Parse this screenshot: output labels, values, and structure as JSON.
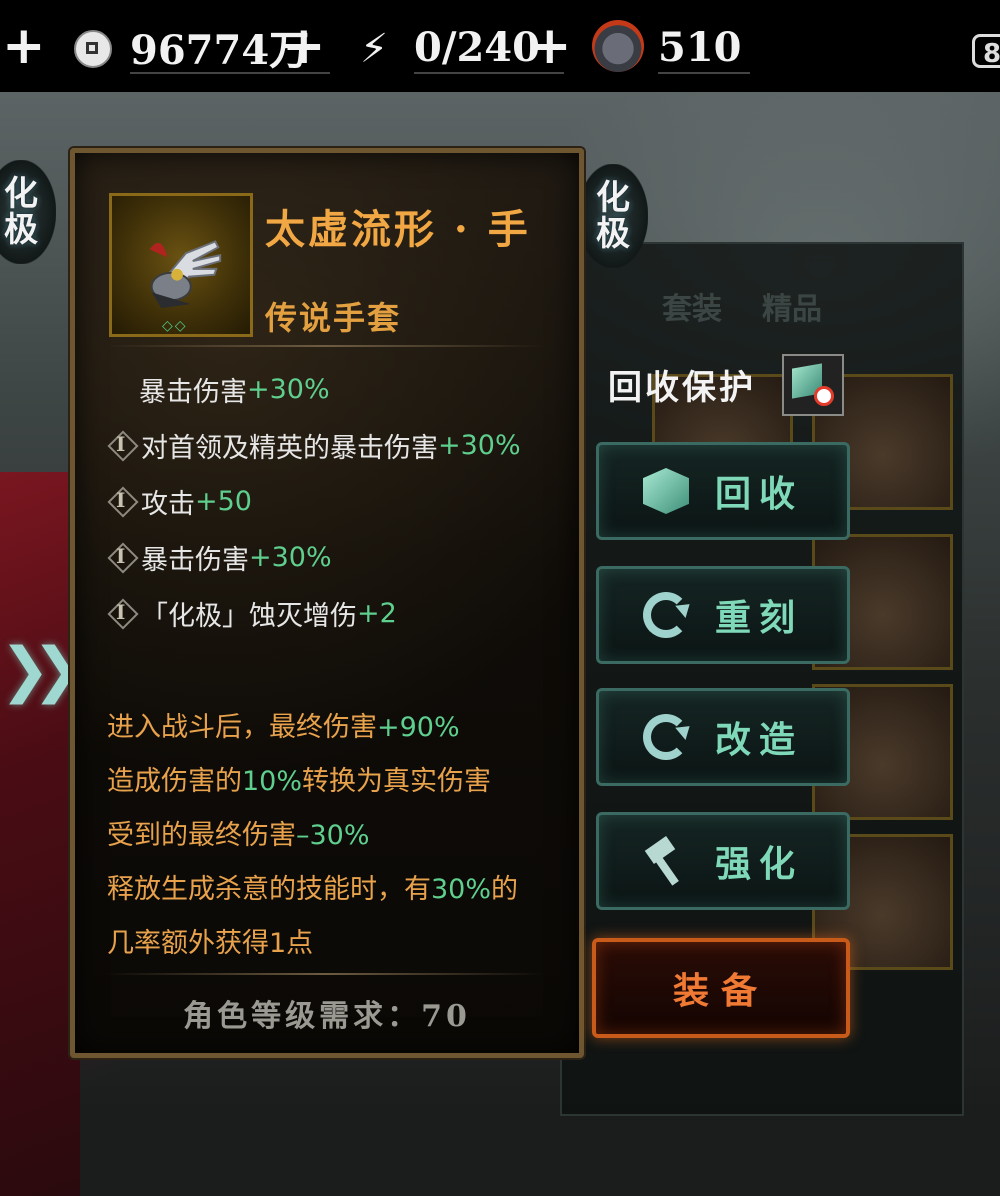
{
  "topbar": {
    "left_plus": "+",
    "currency_value": "96774万",
    "currency_plus": "+",
    "energy_value": "0/240",
    "energy_plus": "+",
    "medal_value": "510",
    "right_value": "8"
  },
  "badges": {
    "left": [
      "化",
      "极"
    ],
    "right": [
      "化",
      "极"
    ]
  },
  "item": {
    "name": "太虚流形 · 手",
    "type": "传说手套",
    "rarity_marks": "◇◇",
    "stats": [
      {
        "label": "暴击伤害",
        "value": "+30%",
        "icon": false
      },
      {
        "label": "对首领及精英的暴击伤害",
        "value": "+30%",
        "icon": true
      },
      {
        "label": "攻击",
        "value": "+50",
        "icon": true
      },
      {
        "label": "暴击伤害",
        "value": "+30%",
        "icon": true
      },
      {
        "label": "「化极」蚀灭增伤",
        "value": "+2",
        "icon": true
      }
    ],
    "effects": [
      {
        "parts": [
          "进入战斗后，最终伤害",
          "+90%",
          ""
        ]
      },
      {
        "parts": [
          "造成伤害的",
          "10%",
          "转换为真实伤害"
        ]
      },
      {
        "parts": [
          "受到的最终伤害",
          "–30%",
          ""
        ]
      },
      {
        "parts": [
          "释放生成杀意的技能时，有",
          "30%",
          "的"
        ]
      },
      {
        "parts": [
          "几率额外获得1点",
          "",
          ""
        ]
      }
    ],
    "requirement": "角色等级需求：70"
  },
  "actions": {
    "protect_label": "回收保护",
    "recycle": "回收",
    "reforge": "重刻",
    "modify": "改造",
    "enhance": "强化",
    "equip": "装备"
  },
  "inventory": {
    "tabs": [
      "套装",
      "精品"
    ]
  },
  "colors": {
    "gold_text": "#f1a743",
    "green_value": "#5fcf8e",
    "button_text": "#7fd9b8",
    "equip_text": "#f07a34"
  }
}
